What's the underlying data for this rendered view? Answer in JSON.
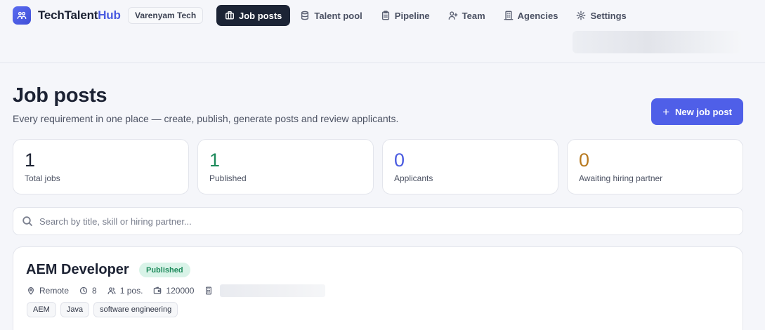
{
  "brand": {
    "name_part1": "TechTalent",
    "name_part2": "Hub",
    "accent_color": "#4a5be0"
  },
  "org_badge": "Varenyam Tech",
  "nav": {
    "items": [
      {
        "label": "Job posts",
        "icon": "briefcase-icon",
        "active": true
      },
      {
        "label": "Talent pool",
        "icon": "database-icon",
        "active": false
      },
      {
        "label": "Pipeline",
        "icon": "clipboard-icon",
        "active": false
      },
      {
        "label": "Team",
        "icon": "user-plus-icon",
        "active": false
      },
      {
        "label": "Agencies",
        "icon": "building-icon",
        "active": false
      },
      {
        "label": "Settings",
        "icon": "gear-icon",
        "active": false
      }
    ]
  },
  "header": {
    "title": "Job posts",
    "subtitle": "Every requirement in one place — create, publish, generate posts and review applicants.",
    "new_button_label": "New job post",
    "button_color": "#4f5fe8"
  },
  "stats": [
    {
      "value": "1",
      "label": "Total jobs",
      "color": "#1c2233"
    },
    {
      "value": "1",
      "label": "Published",
      "color": "#1d8a5b"
    },
    {
      "value": "0",
      "label": "Applicants",
      "color": "#4a5be0"
    },
    {
      "value": "0",
      "label": "Awaiting hiring partner",
      "color": "#b7791f"
    }
  ],
  "search": {
    "placeholder": "Search by title, skill or hiring partner..."
  },
  "jobs": [
    {
      "title": "AEM Developer",
      "status": "Published",
      "location": "Remote",
      "experience": "8",
      "positions": "1 pos.",
      "salary": "120000",
      "tags": [
        "AEM",
        "Java",
        "software engineering"
      ]
    }
  ]
}
